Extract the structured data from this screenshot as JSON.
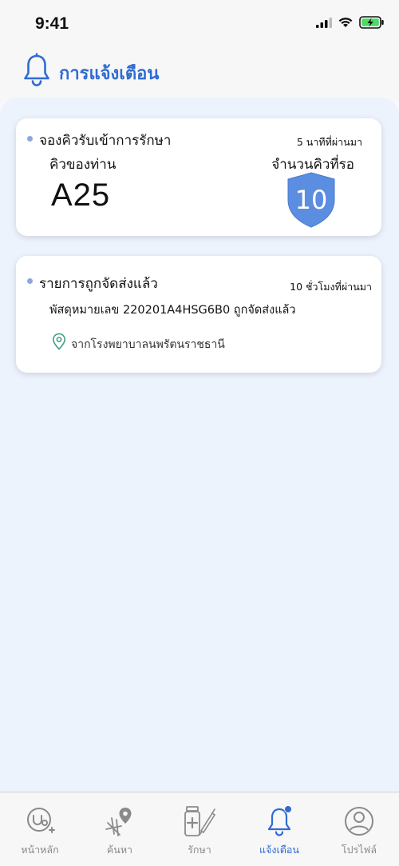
{
  "status_bar": {
    "time": "9:41"
  },
  "header": {
    "title": "การแจ้งเตือน"
  },
  "notifications": [
    {
      "title": "จองคิวรับเข้าการรักษา",
      "time_ago": "5 นาทีที่ผ่านมา",
      "your_queue_label": "คิวของท่าน",
      "your_queue": "A25",
      "waiting_label": "จำนวนคิวที่รอ",
      "waiting_count": "10"
    },
    {
      "title": "รายการถูกจัดส่งแล้ว",
      "time_ago": "10 ชั่วโมงที่ผ่านมา",
      "message": "พัสดุหมายเลข 220201A4HSG6B0 ถูกจัดส่งแล้ว",
      "location": "จากโรงพยาบาลนพรัตนราชธานี"
    }
  ],
  "bottom_nav": [
    {
      "label": "หน้าหลัก",
      "icon": "home-stethoscope-icon"
    },
    {
      "label": "ค้นหา",
      "icon": "map-search-icon"
    },
    {
      "label": "รักษา",
      "icon": "medicine-icon"
    },
    {
      "label": "แจ้งเตือน",
      "icon": "bell-icon",
      "active": true
    },
    {
      "label": "โปรไฟล์",
      "icon": "profile-icon"
    }
  ],
  "colors": {
    "accent": "#2f6bd2",
    "badge": "#5b8ee0",
    "background": "#edf3fd",
    "battery": "#4cd964"
  }
}
